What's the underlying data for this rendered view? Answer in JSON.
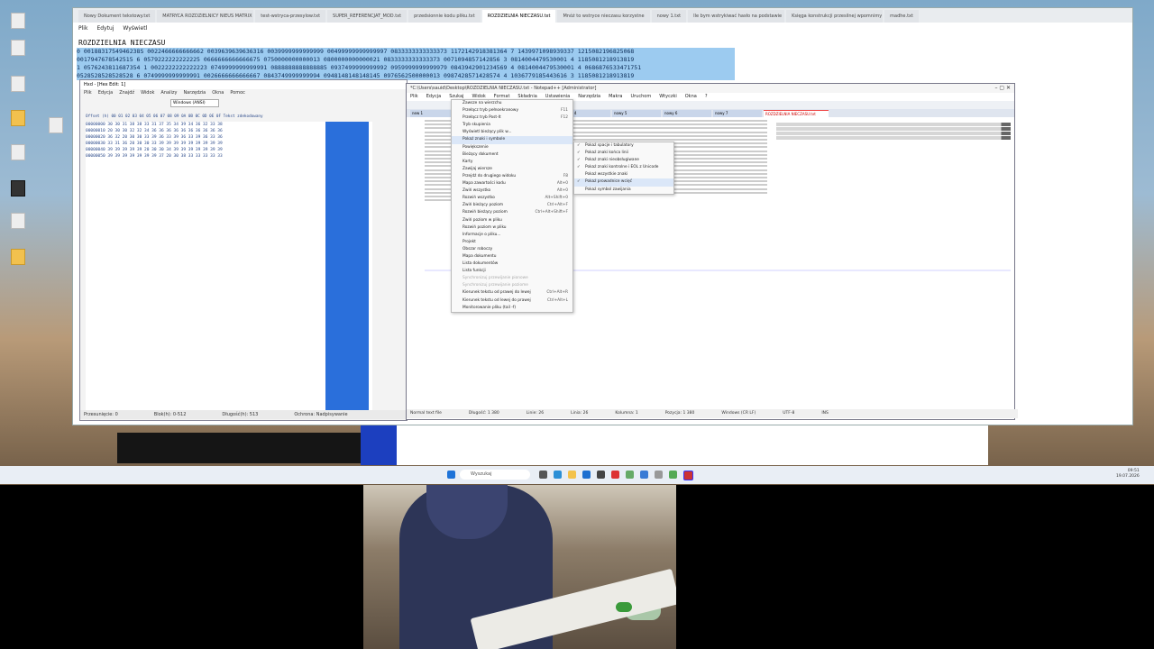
{
  "back_window": {
    "tabs": [
      "Nowy Dokument tekstowy.txt",
      "MATRYCA ROZDZIELNICY NIEUS MATRIX",
      "test-wstryca-przesylow.txt",
      "SUPER_REFERENCJAT_MOD.txt",
      "przedsionnie kodu pliku.txt",
      "ROZDZIELNIA NIECZASU.txt",
      "Mnóż to wstryce nieczasu korzystne",
      "nowy 1.txt",
      "Ile bym wstrykiwać hasło na podstawie",
      "Księga konstrukcji przesilnej wpomnimy",
      "madhe.txt"
    ],
    "active_tab": 5,
    "menu": [
      "Plik",
      "Edytuj",
      "Wyświetl"
    ],
    "doc_title": "ROZDZIELNIA NIECZASU",
    "lines": [
      "0 0018831754946238S 0022466666666662 0039639639636316 0039999999999999 00499999999999997 0833333333333373 1172142918381364 7 1439971098939337 1215082196825068",
      "0017947678542515 6 0579222222222225 0666666666666675 0750000000000013 0800000000000021 0833333333333373 0071094857142856 3 0814004479530001 4 1185081218913819",
      "1 0576243811687354 1 0022222222222223 0749999999999991 0888888888888885 0937499999999992 0959999999999979 0843942901234569 4 0814004479530001 4 0686876533471751",
      "0528528528528528 6 0749999999999991 0026666666666667 0843749999999994 0948148148148145 0976562500000013 0987428571428574 4 1036779185443616 3 1185081218913819"
    ]
  },
  "hex_window": {
    "title": "Hxd - [Hex Edit: 1]",
    "menu": [
      "Plik",
      "Edycja",
      "Znajdź",
      "Widok",
      "Analizy",
      "Narzędzia",
      "Okna",
      "Pomoc"
    ],
    "encoding": "Windows (ANSI)",
    "columns_header": "Offset (h) 00 01 02 03 04 05 06 07 08 09 0A 0B 0C 0D 0E 0F  Tekst zdekodowany",
    "sample_rows": [
      "00000000  30 30 31 38 38 33 31 37 35 34 39 34 36 32 33 38",
      "00000010  20 30 30 32 32 34 36 36 36 36 36 36 36 36 36 36",
      "00000020  36 32 20 30 30 33 39 36 33 39 36 33 39 36 33 36",
      "00000030  33 31 36 20 30 30 33 39 39 39 39 39 39 39 39 39",
      "00000040  39 39 39 39 39 20 30 30 34 39 39 39 39 39 39 39",
      "00000050  39 39 39 39 39 39 39 37 20 30 38 33 33 33 33 33"
    ],
    "status": [
      "Przesunięcie: 0",
      "Blok(h): 0-512",
      "Długość(h): 513",
      "Ochrona: Nadpisywanie"
    ]
  },
  "npp_window": {
    "title": "*C:\\Users\\sauid\\Desktop\\ROZDZIELNIA NIECZASU.txt - Notepad++ [Administrator]",
    "menu": [
      "Plik",
      "Edycja",
      "Szukaj",
      "Widok",
      "Format",
      "Składnia",
      "Ustawienia",
      "Narzędzia",
      "Makra",
      "Uruchom",
      "Wtyczki",
      "Okna",
      "?"
    ],
    "tabs": [
      "new 1",
      "nowy 2",
      "nowy 3",
      "nowy 4",
      "nowy 5",
      "nowy 6",
      "nowy 7",
      "ROZDZIELNIA NIECZASU.txt"
    ],
    "active_tab": 7,
    "status": [
      "Normal text file",
      "Długość: 1 380",
      "Linie: 26",
      "Linia: 26",
      "Kolumna: 1",
      "Pozycja: 1 380",
      "Windows (CR LF)",
      "UTF-8",
      "INS"
    ]
  },
  "context_menu": {
    "items": [
      {
        "label": "Zawsze na wierzchu",
        "sc": ""
      },
      {
        "label": "Przełącz tryb pełnoekranowy",
        "sc": "F11"
      },
      {
        "label": "Przełącz tryb Post-It",
        "sc": "F12"
      },
      {
        "label": "Tryb skupienia",
        "sc": ""
      },
      {
        "label": "Wyświetl bieżący plik w...",
        "sc": ""
      },
      {
        "label": "Pokaż znaki i symbole",
        "sc": ""
      },
      {
        "label": "Powiększenie",
        "sc": ""
      },
      {
        "label": "Bieżący dokument",
        "sc": ""
      },
      {
        "label": "Karty",
        "sc": ""
      },
      {
        "label": "Zawijaj wiersze",
        "sc": ""
      },
      {
        "label": "Przejdź do drugiego widoku",
        "sc": "F8"
      },
      {
        "label": "Mapa zawartości kodu",
        "sc": "Alt+0"
      },
      {
        "label": "Zwiń wszystko",
        "sc": "Alt+0"
      },
      {
        "label": "Rozwiń wszystko",
        "sc": "Alt+Shift+0"
      },
      {
        "label": "Zwiń bieżący poziom",
        "sc": "Ctrl+Alt+F"
      },
      {
        "label": "Rozwiń bieżący poziom",
        "sc": "Ctrl+Alt+Shift+F"
      },
      {
        "label": "Zwiń poziom w pliku",
        "sc": ""
      },
      {
        "label": "Rozwiń poziom w pliku",
        "sc": ""
      },
      {
        "label": "Informacje o pliku...",
        "sc": ""
      },
      {
        "label": "Projekt",
        "sc": ""
      },
      {
        "label": "Obszar roboczy",
        "sc": ""
      },
      {
        "label": "Mapa dokumentu",
        "sc": ""
      },
      {
        "label": "Lista dokumentów",
        "sc": ""
      },
      {
        "label": "Lista funkcji",
        "sc": ""
      },
      {
        "label": "Synchronizuj przewijanie pionowe",
        "sc": "",
        "dis": true
      },
      {
        "label": "Synchronizuj przewijanie poziome",
        "sc": "",
        "dis": true
      },
      {
        "label": "Kierunek tekstu od prawej do lewej",
        "sc": "Ctrl+Alt+R"
      },
      {
        "label": "Kierunek tekstu od lewej do prawej",
        "sc": "Ctrl+Alt+L"
      },
      {
        "label": "Monitorowanie pliku (tail -f)",
        "sc": ""
      }
    ]
  },
  "submenu": {
    "items": [
      {
        "label": "Pokaż spacje i tabulatory",
        "check": true
      },
      {
        "label": "Pokaż znaki końca linii",
        "check": true
      },
      {
        "label": "Pokaż znaki nieobsługiwane",
        "check": true
      },
      {
        "label": "Pokaż znaki kontrolne i EOL z Unicode",
        "check": true
      },
      {
        "label": "Pokaż wszystkie znaki",
        "check": false
      },
      {
        "label": "Pokaż prowadnice wcięć",
        "check": true
      },
      {
        "label": "Pokaż symbol zawijania",
        "check": false
      }
    ],
    "highlighted": 5
  },
  "taskbar": {
    "search_placeholder": "Wyszukaj",
    "clock": "09:51",
    "date": "19.07.2026"
  },
  "colors": {
    "selection": "#9ccbf0",
    "hex_selection": "#2a6fdb",
    "taskbar": "#e9eef5"
  }
}
